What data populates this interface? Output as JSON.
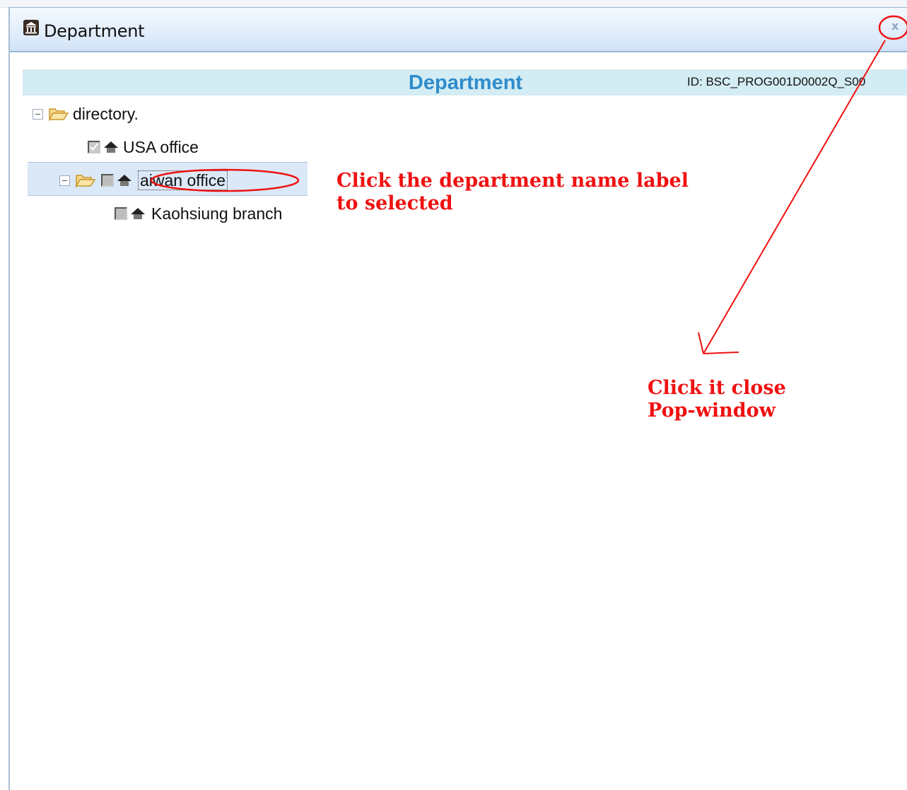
{
  "window": {
    "title": "Department",
    "title_icon": "building-icon",
    "close_label": "x",
    "close_icon": "close-icon"
  },
  "header": {
    "title": "Department",
    "id_text": "ID: BSC_PROG001D0002Q_S00"
  },
  "tree": {
    "root": {
      "label": "directory.",
      "expanded": true,
      "icon": "folder-open-icon"
    },
    "nodes": [
      {
        "label": "USA office",
        "checked": true,
        "icon": "house-icon"
      },
      {
        "label": "Taiwan office",
        "visible_label": "aiwan office",
        "checked": false,
        "expanded": true,
        "selected": true,
        "icon": "house-icon"
      },
      {
        "label": "Kaohsiung branch",
        "checked": false,
        "icon": "house-icon"
      }
    ]
  },
  "annotations": {
    "select_hint_line1": "Click the department name label",
    "select_hint_line2": "to selected",
    "close_hint_line1": "Click it close",
    "close_hint_line2": "Pop-window"
  },
  "colors": {
    "annotation_red": "#ef1111",
    "header_title_blue": "#2e8ccc",
    "header_band": "#d4ecf3",
    "selected_row": "#dbe8f7"
  }
}
